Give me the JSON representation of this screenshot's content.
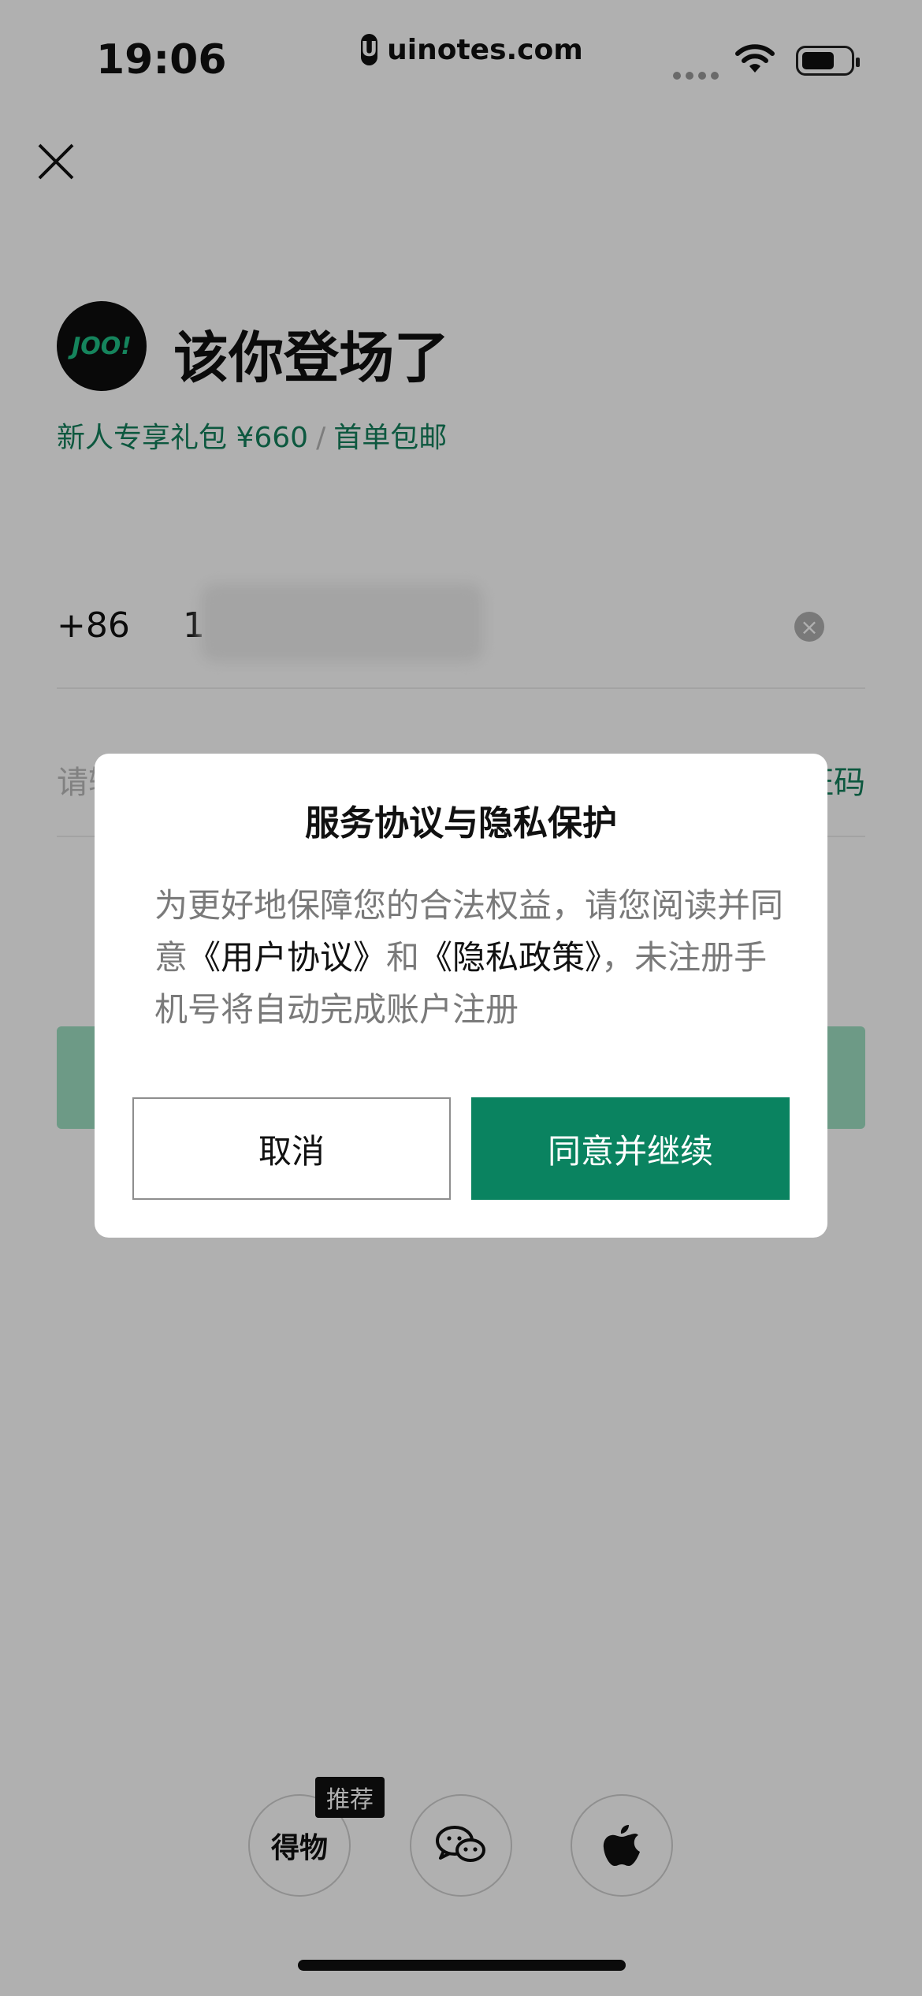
{
  "status_bar": {
    "time": "19:06",
    "url": "uinotes.com",
    "url_logo": "U"
  },
  "page": {
    "brand_logo_text": "JOO!",
    "title": "该你登场了",
    "promo_left": "新人专享礼包 ¥660",
    "promo_sep": "/",
    "promo_right": "首单包邮",
    "country_code": "+86",
    "phone_visible": "1",
    "code_placeholder": "请输入验证码",
    "get_code_link": "获取验证码"
  },
  "social": {
    "dewu_label": "得物",
    "recommend_badge": "推荐",
    "wechat_icon": "wechat-icon",
    "apple_icon": "apple-icon"
  },
  "dialog": {
    "title": "服务协议与隐私保护",
    "body_part1": "为更好地保障您的合法权益，请您阅读并同意",
    "user_agreement": "《用户协议》",
    "body_and": "和",
    "privacy_policy": "《隐私政策》",
    "body_part2": "，未注册手机号将自动完成账户注册",
    "cancel_label": "取消",
    "agree_label": "同意并继续"
  },
  "colors": {
    "accent": "#0a8360",
    "accent_light": "#9fe0c3",
    "overlay": "rgba(0,0,0,0.31)"
  }
}
